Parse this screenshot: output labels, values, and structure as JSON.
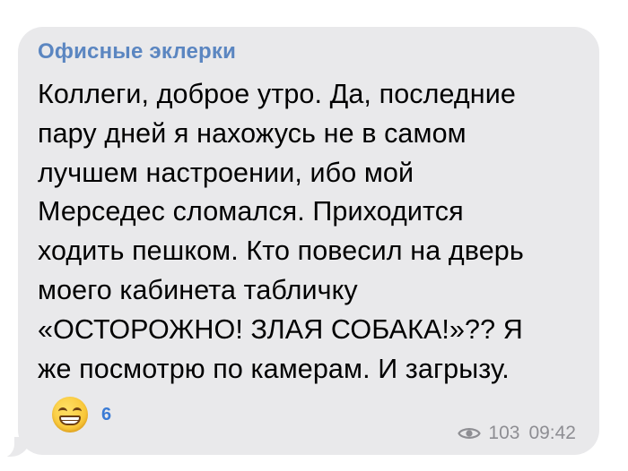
{
  "message": {
    "sender": "Офисные эклерки",
    "lines": [
      "Коллеги, доброе утро. Да, последние",
      "пару дней я нахожусь не в самом",
      "лучшем настроении, ибо мой",
      "Мерседес сломался. Приходится",
      "ходить пешком. Кто повесил на дверь",
      "моего кабинета табличку",
      "«ОСТОРОЖНО! ЗЛАЯ СОБАКА!»?? Я",
      "же посмотрю по камерам. И загрызу."
    ],
    "reaction": {
      "icon": "grinning-face-emoji",
      "count": "6"
    },
    "views_icon": "eye-icon",
    "views": "103",
    "time": "09:42"
  },
  "colors": {
    "bubble": "#e9e9eb",
    "sender": "#5b86c1",
    "reaction_count": "#3a7bd5",
    "meta": "#8e8e93"
  }
}
